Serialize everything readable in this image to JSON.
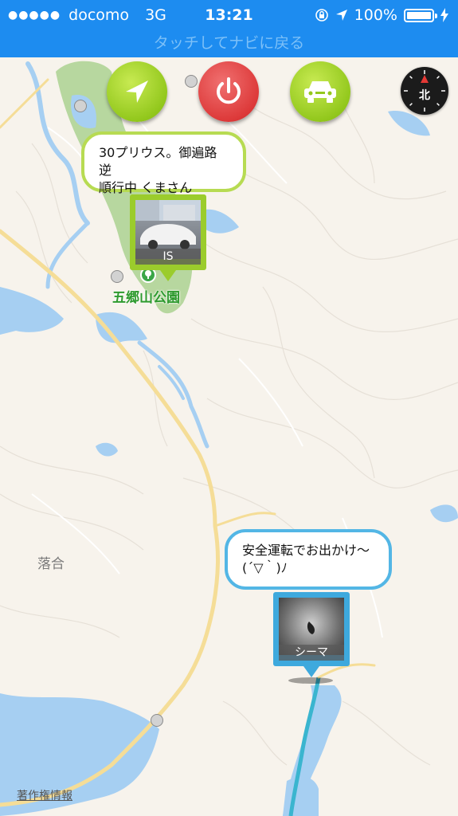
{
  "status_bar": {
    "carrier": "docomo",
    "network": "3G",
    "time": "13:21",
    "battery": "100%",
    "battery_level": 1.0
  },
  "back_bar": {
    "text": "タッチしてナビに戻る"
  },
  "buttons": {
    "locate": "location-arrow-icon",
    "power": "power-icon",
    "car": "car-icon"
  },
  "compass": {
    "label": "北"
  },
  "markers": [
    {
      "bubble_line1": "30プリウス。御遍路逆",
      "bubble_line2": "順行中 くまさん",
      "name": "IS",
      "color": "#9bcc2c"
    },
    {
      "bubble_line1": "安全運転でお出かけ〜",
      "bubble_line2": "(´▽｀)ﾉ",
      "name": "シーマ",
      "color": "#3ea9dd"
    }
  ],
  "map_labels": {
    "park": "五郷山公園",
    "area": "落合",
    "attribution": "著作権情報"
  },
  "colors": {
    "header_blue": "#1d8cf0",
    "water": "#a6cff2",
    "road": "#f5dd97",
    "park_green": "#b7d79f",
    "park_label": "#2e9a2e"
  }
}
